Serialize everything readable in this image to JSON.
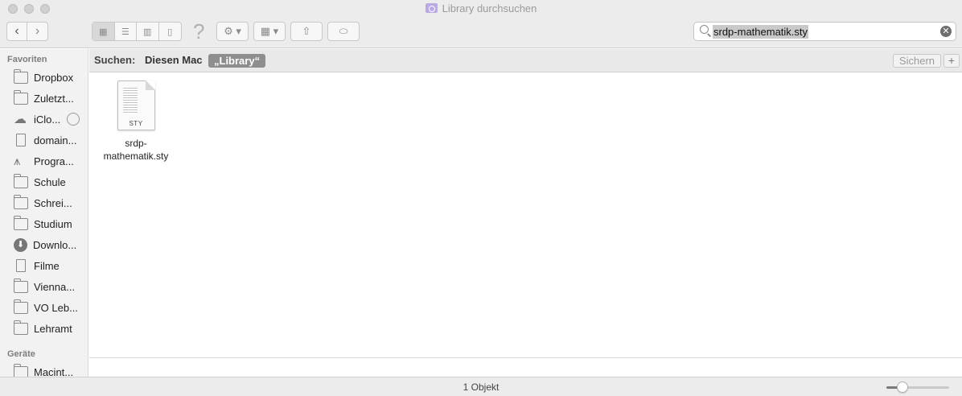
{
  "window": {
    "title": "Library durchsuchen"
  },
  "toolbar": {
    "back_icon": "‹",
    "forward_icon": "›",
    "view_modes": [
      {
        "name": "icon-view",
        "glyph": "▦",
        "active": true
      },
      {
        "name": "list-view",
        "glyph": "☰",
        "active": false
      },
      {
        "name": "column-view",
        "glyph": "▥",
        "active": false
      },
      {
        "name": "gallery-view",
        "glyph": "▯",
        "active": false
      }
    ],
    "help_glyph": "?",
    "gear_glyph": "⚙ ▾",
    "group_glyph": "▦ ▾",
    "share_glyph": "⇧",
    "tag_glyph": "⬭"
  },
  "search": {
    "value": "srdp-mathematik.sty",
    "clear_glyph": "✕"
  },
  "sidebar": {
    "sections": [
      {
        "title": "Favoriten",
        "items": [
          {
            "label": "Dropbox",
            "icon": "folder-icon"
          },
          {
            "label": "Zuletzt...",
            "icon": "recents-icon"
          },
          {
            "label": "iClo...",
            "icon": "icloud-icon"
          },
          {
            "label": "domain...",
            "icon": "document-icon"
          },
          {
            "label": "Progra...",
            "icon": "applications-icon"
          },
          {
            "label": "Schule",
            "icon": "folder-icon"
          },
          {
            "label": "Schrei...",
            "icon": "desktop-icon"
          },
          {
            "label": "Studium",
            "icon": "folder-icon"
          },
          {
            "label": "Downlo...",
            "icon": "downloads-icon"
          },
          {
            "label": "Filme",
            "icon": "movies-icon"
          },
          {
            "label": "Vienna...",
            "icon": "folder-icon"
          },
          {
            "label": "VO Leb...",
            "icon": "folder-icon"
          },
          {
            "label": "Lehramt",
            "icon": "folder-icon"
          }
        ]
      },
      {
        "title": "Geräte",
        "items": [
          {
            "label": "Macint...",
            "icon": "harddisk-icon"
          }
        ]
      }
    ]
  },
  "scopebar": {
    "label": "Suchen:",
    "scope_mac": "Diesen Mac",
    "scope_library": "„Library“",
    "save_label": "Sichern",
    "add_label": "+"
  },
  "results": [
    {
      "name": "srdp-mathematik.sty",
      "name_line1": "srdp-",
      "name_line2": "mathematik.sty",
      "ext": "STY"
    }
  ],
  "status": {
    "text": "1 Objekt",
    "zoom_level": 0.2
  }
}
